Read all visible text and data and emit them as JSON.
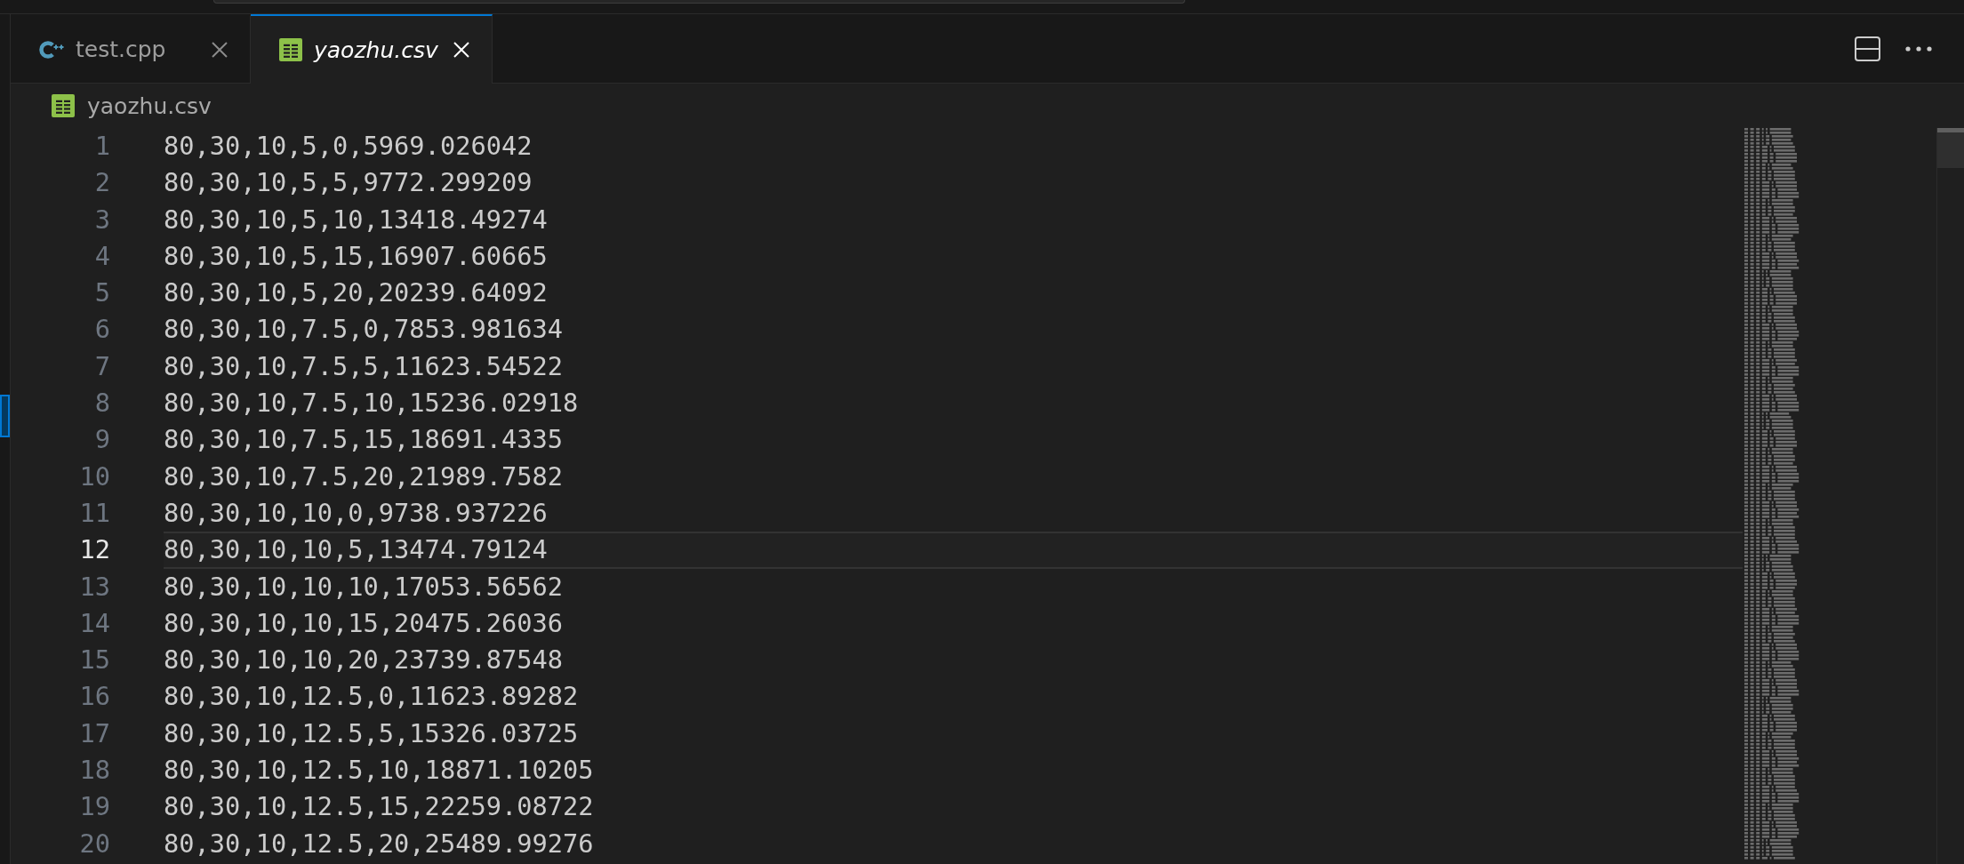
{
  "tabs": [
    {
      "label": "test.cpp",
      "kind": "cpp",
      "selected": false,
      "preview": false
    },
    {
      "label": "yaozhu.csv",
      "kind": "csv",
      "selected": true,
      "preview": true
    }
  ],
  "breadcrumb": [
    {
      "label": "yaozhu.csv",
      "kind": "csv"
    }
  ],
  "editor": {
    "lines": [
      {
        "number": "1",
        "text": "80,30,10,5,0,5969.026042",
        "current": false
      },
      {
        "number": "2",
        "text": "80,30,10,5,5,9772.299209",
        "current": false
      },
      {
        "number": "3",
        "text": "80,30,10,5,10,13418.49274",
        "current": false
      },
      {
        "number": "4",
        "text": "80,30,10,5,15,16907.60665",
        "current": false
      },
      {
        "number": "5",
        "text": "80,30,10,5,20,20239.64092",
        "current": false
      },
      {
        "number": "6",
        "text": "80,30,10,7.5,0,7853.981634",
        "current": false
      },
      {
        "number": "7",
        "text": "80,30,10,7.5,5,11623.54522",
        "current": false
      },
      {
        "number": "8",
        "text": "80,30,10,7.5,10,15236.02918",
        "current": false
      },
      {
        "number": "9",
        "text": "80,30,10,7.5,15,18691.4335",
        "current": false
      },
      {
        "number": "10",
        "text": "80,30,10,7.5,20,21989.7582",
        "current": false
      },
      {
        "number": "11",
        "text": "80,30,10,10,0,9738.937226",
        "current": false
      },
      {
        "number": "12",
        "text": "80,30,10,10,5,13474.79124",
        "current": true
      },
      {
        "number": "13",
        "text": "80,30,10,10,10,17053.56562",
        "current": false
      },
      {
        "number": "14",
        "text": "80,30,10,10,15,20475.26036",
        "current": false
      },
      {
        "number": "15",
        "text": "80,30,10,10,20,23739.87548",
        "current": false
      },
      {
        "number": "16",
        "text": "80,30,10,12.5,0,11623.89282",
        "current": false
      },
      {
        "number": "17",
        "text": "80,30,10,12.5,5,15326.03725",
        "current": false
      },
      {
        "number": "18",
        "text": "80,30,10,12.5,10,18871.10205",
        "current": false
      },
      {
        "number": "19",
        "text": "80,30,10,12.5,15,22259.08722",
        "current": false
      },
      {
        "number": "20",
        "text": "80,30,10,12.5,20,25489.99276",
        "current": false
      }
    ]
  }
}
